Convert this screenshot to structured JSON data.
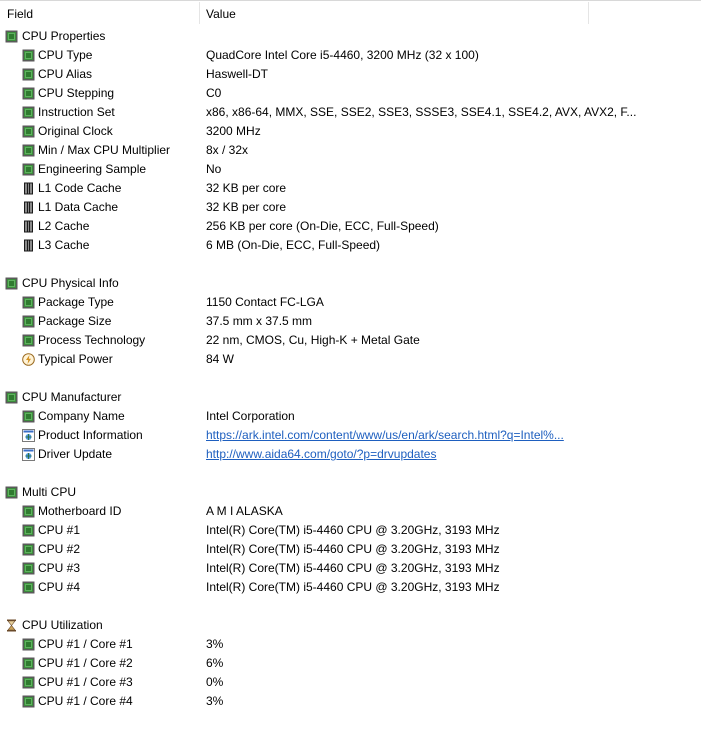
{
  "columns": {
    "field": "Field",
    "value": "Value"
  },
  "colors": {
    "chip_green": "#3c8c3c",
    "link": "#1e5fbf"
  },
  "rows": [
    {
      "kind": "cat",
      "icon": "cpu-chip-icon",
      "label": "CPU Properties",
      "value": ""
    },
    {
      "kind": "item",
      "icon": "cpu-chip-icon",
      "label": "CPU Type",
      "value": "QuadCore Intel Core i5-4460, 3200 MHz (32 x 100)"
    },
    {
      "kind": "item",
      "icon": "cpu-chip-icon",
      "label": "CPU Alias",
      "value": "Haswell-DT"
    },
    {
      "kind": "item",
      "icon": "cpu-chip-icon",
      "label": "CPU Stepping",
      "value": "C0"
    },
    {
      "kind": "item",
      "icon": "cpu-chip-icon",
      "label": "Instruction Set",
      "value": "x86, x86-64, MMX, SSE, SSE2, SSE3, SSSE3, SSE4.1, SSE4.2, AVX, AVX2, F..."
    },
    {
      "kind": "item",
      "icon": "cpu-chip-icon",
      "label": "Original Clock",
      "value": "3200 MHz"
    },
    {
      "kind": "item",
      "icon": "cpu-chip-icon",
      "label": "Min / Max CPU Multiplier",
      "value": "8x / 32x"
    },
    {
      "kind": "item",
      "icon": "cpu-chip-icon",
      "label": "Engineering Sample",
      "value": "No"
    },
    {
      "kind": "item",
      "icon": "memory-module-icon",
      "label": "L1 Code Cache",
      "value": "32 KB per core"
    },
    {
      "kind": "item",
      "icon": "memory-module-icon",
      "label": "L1 Data Cache",
      "value": "32 KB per core"
    },
    {
      "kind": "item",
      "icon": "memory-module-icon",
      "label": "L2 Cache",
      "value": "256 KB per core  (On-Die, ECC, Full-Speed)"
    },
    {
      "kind": "item",
      "icon": "memory-module-icon",
      "label": "L3 Cache",
      "value": "6 MB  (On-Die, ECC, Full-Speed)"
    },
    {
      "kind": "blank"
    },
    {
      "kind": "cat",
      "icon": "cpu-chip-icon",
      "label": "CPU Physical Info",
      "value": ""
    },
    {
      "kind": "item",
      "icon": "cpu-chip-icon",
      "label": "Package Type",
      "value": "1150 Contact FC-LGA"
    },
    {
      "kind": "item",
      "icon": "cpu-chip-icon",
      "label": "Package Size",
      "value": "37.5 mm x 37.5 mm"
    },
    {
      "kind": "item",
      "icon": "cpu-chip-icon",
      "label": "Process Technology",
      "value": "22 nm, CMOS, Cu, High-K + Metal Gate"
    },
    {
      "kind": "item",
      "icon": "power-bolt-icon",
      "label": "Typical Power",
      "value": "84 W"
    },
    {
      "kind": "blank"
    },
    {
      "kind": "cat",
      "icon": "cpu-chip-icon",
      "label": "CPU Manufacturer",
      "value": ""
    },
    {
      "kind": "item",
      "icon": "cpu-chip-icon",
      "label": "Company Name",
      "value": "Intel Corporation"
    },
    {
      "kind": "item",
      "icon": "web-link-icon",
      "label": "Product Information",
      "value": "https://ark.intel.com/content/www/us/en/ark/search.html?q=Intel%...",
      "link": true
    },
    {
      "kind": "item",
      "icon": "web-link-icon",
      "label": "Driver Update",
      "value": "http://www.aida64.com/goto/?p=drvupdates",
      "link": true
    },
    {
      "kind": "blank"
    },
    {
      "kind": "cat",
      "icon": "cpu-chip-icon",
      "label": "Multi CPU",
      "value": ""
    },
    {
      "kind": "item",
      "icon": "cpu-chip-icon",
      "label": "Motherboard ID",
      "value": "A M I ALASKA"
    },
    {
      "kind": "item",
      "icon": "cpu-chip-icon",
      "label": "CPU #1",
      "value": "Intel(R) Core(TM) i5-4460 CPU @ 3.20GHz, 3193 MHz"
    },
    {
      "kind": "item",
      "icon": "cpu-chip-icon",
      "label": "CPU #2",
      "value": "Intel(R) Core(TM) i5-4460 CPU @ 3.20GHz, 3193 MHz"
    },
    {
      "kind": "item",
      "icon": "cpu-chip-icon",
      "label": "CPU #3",
      "value": "Intel(R) Core(TM) i5-4460 CPU @ 3.20GHz, 3193 MHz"
    },
    {
      "kind": "item",
      "icon": "cpu-chip-icon",
      "label": "CPU #4",
      "value": "Intel(R) Core(TM) i5-4460 CPU @ 3.20GHz, 3193 MHz"
    },
    {
      "kind": "blank"
    },
    {
      "kind": "cat",
      "icon": "hourglass-icon",
      "label": "CPU Utilization",
      "value": ""
    },
    {
      "kind": "item",
      "icon": "cpu-chip-icon",
      "label": "CPU #1 / Core #1",
      "value": "3%"
    },
    {
      "kind": "item",
      "icon": "cpu-chip-icon",
      "label": "CPU #1 / Core #2",
      "value": "6%"
    },
    {
      "kind": "item",
      "icon": "cpu-chip-icon",
      "label": "CPU #1 / Core #3",
      "value": "0%"
    },
    {
      "kind": "item",
      "icon": "cpu-chip-icon",
      "label": "CPU #1 / Core #4",
      "value": "3%"
    }
  ]
}
